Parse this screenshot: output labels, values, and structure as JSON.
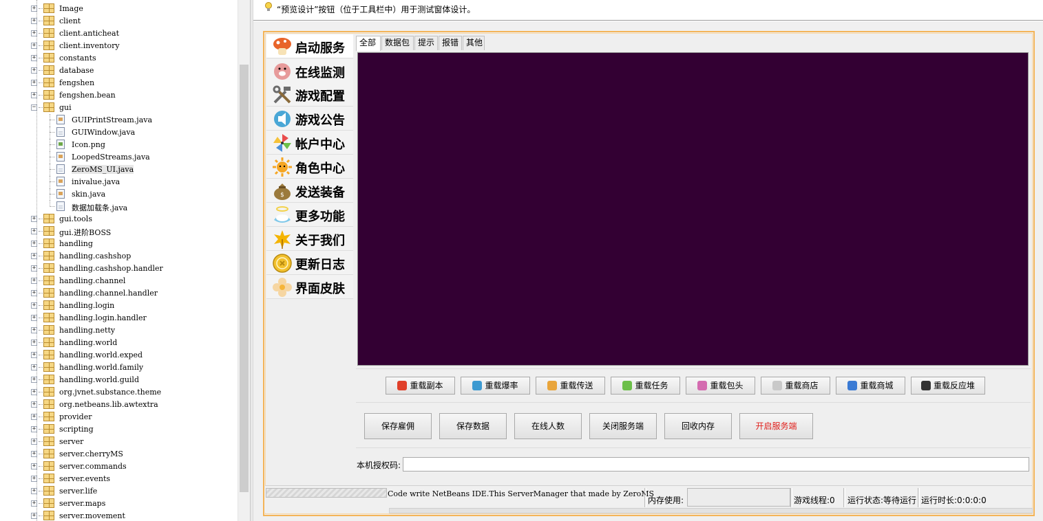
{
  "tree": {
    "items": [
      {
        "label": "Image",
        "kind": "package"
      },
      {
        "label": "client",
        "kind": "package"
      },
      {
        "label": "client.anticheat",
        "kind": "package"
      },
      {
        "label": "client.inventory",
        "kind": "package"
      },
      {
        "label": "constants",
        "kind": "package"
      },
      {
        "label": "database",
        "kind": "package"
      },
      {
        "label": "fengshen",
        "kind": "package"
      },
      {
        "label": "fengshen.bean",
        "kind": "package"
      },
      {
        "label": "gui",
        "kind": "package-open"
      },
      {
        "label": "GUIPrintStream.java",
        "kind": "java"
      },
      {
        "label": "GUIWindow.java",
        "kind": "form"
      },
      {
        "label": "Icon.png",
        "kind": "image"
      },
      {
        "label": "LoopedStreams.java",
        "kind": "java"
      },
      {
        "label": "ZeroMS_UI.java",
        "kind": "form",
        "selected": true
      },
      {
        "label": "inivalue.java",
        "kind": "java"
      },
      {
        "label": "skin.java",
        "kind": "java"
      },
      {
        "label": "数据加载条.java",
        "kind": "form"
      },
      {
        "label": "gui.tools",
        "kind": "package"
      },
      {
        "label": "gui.进阶BOSS",
        "kind": "package"
      },
      {
        "label": "handling",
        "kind": "package"
      },
      {
        "label": "handling.cashshop",
        "kind": "package"
      },
      {
        "label": "handling.cashshop.handler",
        "kind": "package"
      },
      {
        "label": "handling.channel",
        "kind": "package"
      },
      {
        "label": "handling.channel.handler",
        "kind": "package"
      },
      {
        "label": "handling.login",
        "kind": "package"
      },
      {
        "label": "handling.login.handler",
        "kind": "package"
      },
      {
        "label": "handling.netty",
        "kind": "package"
      },
      {
        "label": "handling.world",
        "kind": "package"
      },
      {
        "label": "handling.world.exped",
        "kind": "package"
      },
      {
        "label": "handling.world.family",
        "kind": "package"
      },
      {
        "label": "handling.world.guild",
        "kind": "package"
      },
      {
        "label": "org.jvnet.substance.theme",
        "kind": "package"
      },
      {
        "label": "org.netbeans.lib.awtextra",
        "kind": "package"
      },
      {
        "label": "provider",
        "kind": "package"
      },
      {
        "label": "scripting",
        "kind": "package"
      },
      {
        "label": "server",
        "kind": "package"
      },
      {
        "label": "server.cherryMS",
        "kind": "package"
      },
      {
        "label": "server.commands",
        "kind": "package"
      },
      {
        "label": "server.events",
        "kind": "package"
      },
      {
        "label": "server.life",
        "kind": "package"
      },
      {
        "label": "server.maps",
        "kind": "package"
      },
      {
        "label": "server.movement",
        "kind": "package"
      }
    ]
  },
  "hint": {
    "icon": "lightbulb-icon",
    "text": "“预览设计”按钮（位于工具栏中）用于测试窗体设计。"
  },
  "nav": {
    "items": [
      {
        "label": "启动服务",
        "icon": "mushroom-icon",
        "color": "#e8642a"
      },
      {
        "label": "在线监测",
        "icon": "pig-icon",
        "color": "#e79b9b"
      },
      {
        "label": "游戏配置",
        "icon": "tools-icon",
        "color": "#6c6c6c"
      },
      {
        "label": "游戏公告",
        "icon": "speaker-icon",
        "color": "#4aa7d6"
      },
      {
        "label": "帐户中心",
        "icon": "pinwheel-icon",
        "color": "#6cbf49"
      },
      {
        "label": "角色中心",
        "icon": "sun-icon",
        "color": "#f5a623"
      },
      {
        "label": "发送装备",
        "icon": "money-bag-icon",
        "color": "#9b7a3c"
      },
      {
        "label": "更多功能",
        "icon": "angel-icon",
        "color": "#7fc8ea"
      },
      {
        "label": "关于我们",
        "icon": "maple-leaf-icon",
        "color": "#f4b400"
      },
      {
        "label": "更新日志",
        "icon": "coin-icon",
        "color": "#f2c12e"
      },
      {
        "label": "界面皮肤",
        "icon": "flower-icon",
        "color": "#f6d6a2"
      }
    ]
  },
  "tabs": [
    "全部",
    "数据包",
    "提示",
    "报错",
    "其他"
  ],
  "reload_buttons": [
    {
      "label": "重载副本",
      "icon": "maple-leaf-icon",
      "color": "#e0402a"
    },
    {
      "label": "重载爆率",
      "icon": "gear-icon",
      "color": "#3d9ad1"
    },
    {
      "label": "重载传送",
      "icon": "mushroom-icon",
      "color": "#e9a53b"
    },
    {
      "label": "重载任务",
      "icon": "slime-icon",
      "color": "#6cbf49"
    },
    {
      "label": "重载包头",
      "icon": "pig-icon",
      "color": "#d46bb0"
    },
    {
      "label": "重载商店",
      "icon": "envelope-icon",
      "color": "#c9c9c9"
    },
    {
      "label": "重载商城",
      "icon": "mail-icon",
      "color": "#3b7bd4"
    },
    {
      "label": "重载反应堆",
      "icon": "panda-icon",
      "color": "#333333"
    }
  ],
  "action_buttons": [
    {
      "label": "保存雇佣"
    },
    {
      "label": "保存数据"
    },
    {
      "label": "在线人数"
    },
    {
      "label": "关闭服务端"
    },
    {
      "label": "回收内存"
    },
    {
      "label": "开启服务端",
      "color": "#e0201c"
    }
  ],
  "auth": {
    "label": "本机授权码:",
    "value": ""
  },
  "status": {
    "credit": "Code write NetBeans IDE.This ServerManager that made by ZeroMS",
    "memory_label": "内存使用:",
    "threads": "游戏线程:0",
    "run_state": "运行状态:等待运行",
    "uptime": "运行时长:0:0:0:0"
  },
  "colors": {
    "console_bg": "#330033",
    "frame_border": "#f4b458"
  }
}
